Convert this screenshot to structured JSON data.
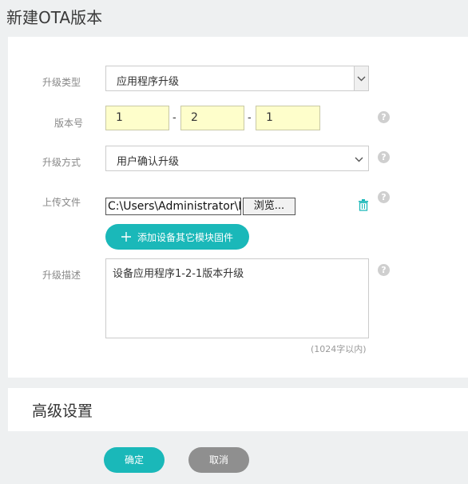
{
  "page": {
    "title": "新建OTA版本"
  },
  "form": {
    "upgrade_type": {
      "label": "升级类型",
      "value": "应用程序升级"
    },
    "version": {
      "label": "版本号",
      "major": "1",
      "minor": "2",
      "patch": "1",
      "separator": "-"
    },
    "upgrade_method": {
      "label": "升级方式",
      "value": "用户确认升级"
    },
    "upload": {
      "label": "上传文件",
      "file_path": "C:\\Users\\Administrator\\D",
      "browse_label": "浏览...",
      "add_module_label": "添加设备其它模块固件"
    },
    "description": {
      "label": "升级描述",
      "value": "设备应用程序1-2-1版本升级",
      "limit_hint": "(1024字以内)"
    },
    "help_glyph": "?"
  },
  "advanced": {
    "title": "高级设置"
  },
  "actions": {
    "confirm_label": "确定",
    "cancel_label": "取消"
  },
  "colors": {
    "accent": "#1ab8b9",
    "cancel": "#8f8f8f",
    "version_bg": "#fefecb"
  },
  "icons": {
    "delete": "trash-icon",
    "add": "plus-icon",
    "help": "help-icon",
    "dropdown": "chevron-down-icon"
  }
}
